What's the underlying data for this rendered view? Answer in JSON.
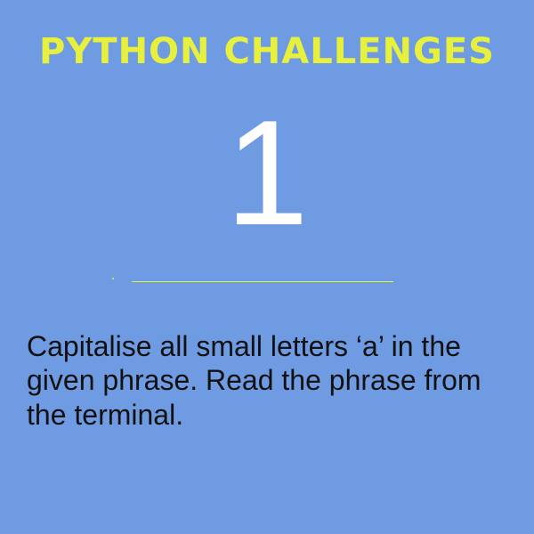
{
  "card": {
    "title": "PYTHON CHALLENGES",
    "number": "1",
    "prompt": "Capitalise all small letters ‘a’ in the given phrase. Read the phrase from the terminal."
  },
  "colors": {
    "background": "#6f9be3",
    "accent": "#e7f13d",
    "number": "#ffffff",
    "text": "#111111"
  }
}
